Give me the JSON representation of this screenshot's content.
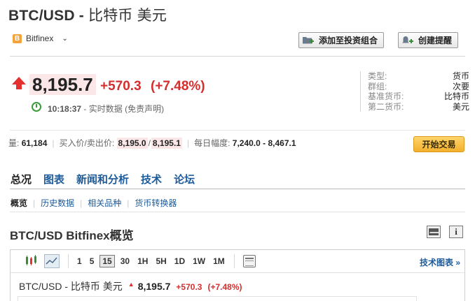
{
  "header": {
    "title_code": "BTC/USD -",
    "title_cn": "比特币 美元"
  },
  "exchange": {
    "badge": "B",
    "name": "Bitfinex",
    "chevron": "⌄"
  },
  "actions": {
    "add_portfolio": "添加至投资组合",
    "create_alert": "创建提醒"
  },
  "quote": {
    "price": "8,195.7",
    "change": "+570.3",
    "change_pct": "(+7.48%)",
    "time": "10:18:37",
    "time_label": "- 实时数据",
    "disclaimer_open": "(",
    "disclaimer": "免责声明",
    "disclaimer_close": ")"
  },
  "info": [
    {
      "key": "类型:",
      "value": "货币"
    },
    {
      "key": "群组:",
      "value": "次要"
    },
    {
      "key": "基准货币:",
      "value": "比特币"
    },
    {
      "key": "第二货币:",
      "value": "美元"
    }
  ],
  "stats": {
    "volume_label": "量:",
    "volume": "61,184",
    "bidask_label": "买入价/卖出价:",
    "bid": "8,195.0",
    "slash": "/",
    "ask": "8,195.1",
    "range_label": "每日幅度:",
    "range": "7,240.0 - 8,467.1"
  },
  "trade_button": "开始交易",
  "tabs": [
    "总况",
    "图表",
    "新闻和分析",
    "技术",
    "论坛"
  ],
  "subtabs": [
    "概览",
    "历史数据",
    "相关品种",
    "货币转换器"
  ],
  "section_title": "BTC/USD Bitfinex概览",
  "chart": {
    "intervals": [
      "1",
      "5",
      "15",
      "30",
      "1H",
      "5H",
      "1D",
      "1W",
      "1M"
    ],
    "active_interval": "15",
    "tech_chart_link": "技术图表 »",
    "quote_label": "BTC/USD - 比特币 美元",
    "quote_arrow": "▲",
    "quote_price": "8,195.7",
    "quote_change": "+570.3",
    "quote_change_pct": "(+7.48%)"
  },
  "colors": {
    "up": "#d32f2f",
    "link": "#1d5b9b",
    "trade": "#f3b02e",
    "highlight": "#fbe7e7"
  }
}
